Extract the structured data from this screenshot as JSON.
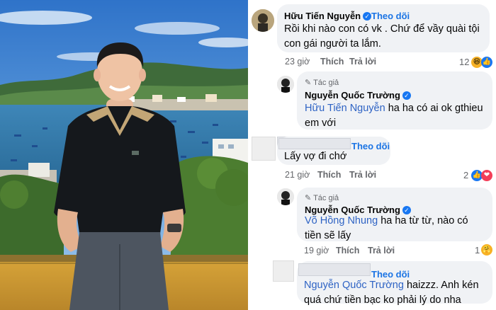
{
  "comments": [
    {
      "author": "Hữu Tiến Nguyễn",
      "follow": "Theo dõi",
      "text": "Rồi khi nào con có vk . Chứ để vầy quài tội con gái người ta lắm.",
      "time": "23 giờ",
      "like": "Thích",
      "reply": "Trả lời",
      "react_count": "12"
    },
    {
      "author_tag": "Tác giả",
      "author": "Nguyễn Quốc Trường",
      "mention": "Hữu Tiến Nguyễn",
      "text": " ha ha có ai ok gthieu em với"
    },
    {
      "follow": "Theo dõi",
      "text": "Lấy vợ đi chớ",
      "time": "21 giờ",
      "like": "Thích",
      "reply": "Trả lời",
      "react_count": "2"
    },
    {
      "author_tag": "Tác giả",
      "author": "Nguyễn Quốc Trường",
      "mention": "Võ Hồng Nhung",
      "text": " ha ha từ từ, nào có tiền sẽ lấy",
      "time": "19 giờ",
      "like": "Thích",
      "reply": "Trả lời",
      "react_count": "1"
    },
    {
      "follow": "Theo dõi",
      "mention": "Nguyễn Quốc Trường",
      "text": " haizzz. Anh kén quá chứ tiền bạc ko phải lý do nha kakaka"
    }
  ]
}
